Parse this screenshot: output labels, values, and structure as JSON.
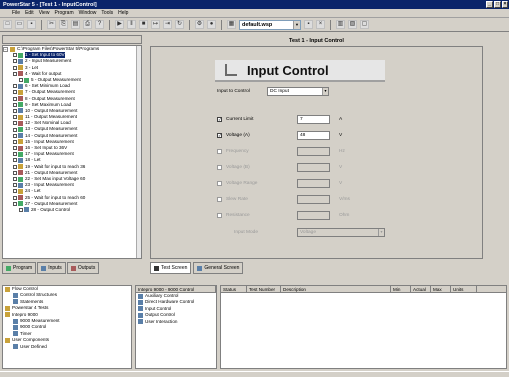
{
  "window": {
    "title": "PowerStar 5 - [Test 1 - InputControl]"
  },
  "menu": [
    "File",
    "Edit",
    "View",
    "Program",
    "Window",
    "Tools",
    "Help"
  ],
  "toolbar": {
    "workspace_combo": "default.wsp"
  },
  "tree": {
    "root": "C:\\Program Files\\PowerStar 5\\Programs",
    "items": [
      "1 - Set Input to 60V",
      "2 - Input Measurement",
      "3 - Let",
      "4 - Wait for output",
      "5 - Output Measurement",
      "6 - Set Minimum Load",
      "7 - Output Measurement",
      "8 - Output Measurement",
      "9 - Set Maximum Load",
      "10 - Output Measurement",
      "11 - Output Measurement",
      "12 - Set Nominal Load",
      "13 - Output Measurement",
      "14 - Output Measurement",
      "15 - Input Measurement",
      "16 - Set Input to 36V",
      "17 - Input Measurement",
      "18 - Let",
      "19 - Wait for input to reach 36",
      "21 - Output Measurement",
      "22 - Set Max input Voltage 60",
      "23 - Input Measurement",
      "24 - Let",
      "25 - Wait for input to reach 60",
      "27 - Output Measurement",
      "28 - Output Control"
    ]
  },
  "left_tabs": [
    "Program",
    "Inputs",
    "Outputs"
  ],
  "content": {
    "header": "Test 1 - Input Control",
    "title": "Input Control",
    "input_to_control_label": "Input to Control",
    "input_to_control_value": "DC Input",
    "fields": [
      {
        "label": "Current Limit",
        "value": "7",
        "unit": "A",
        "checked": true,
        "enabled": true
      },
      {
        "label": "Voltage (A)",
        "value": "48",
        "unit": "V",
        "checked": true,
        "enabled": true
      },
      {
        "label": "Frequency",
        "value": "",
        "unit": "Hz",
        "checked": false,
        "enabled": false
      },
      {
        "label": "Voltage (B)",
        "value": "",
        "unit": "V",
        "checked": false,
        "enabled": false
      },
      {
        "label": "Voltage Range",
        "value": "",
        "unit": "V",
        "checked": false,
        "enabled": false
      },
      {
        "label": "Slew Rate",
        "value": "",
        "unit": "V/ms",
        "checked": false,
        "enabled": false
      },
      {
        "label": "Resistance",
        "value": "",
        "unit": "Ohm",
        "checked": false,
        "enabled": false
      }
    ],
    "mode_label": "Input Mode",
    "mode_value": "Voltage"
  },
  "mid_tabs": [
    "Test Screen",
    "General Screen"
  ],
  "lib_tree": [
    "Flow Control",
    "Control Structures",
    "Statements",
    "Powerstar 4 Tests",
    "Intepro 9000",
    "9000 Measurement",
    "9000 Control",
    "Timer",
    "User Components",
    "User Defined"
  ],
  "lib_list": {
    "header": "Intepro 9000 - 9000 Control",
    "items": [
      "Auxiliary Control",
      "Direct Hardware Control",
      "Input Control",
      "Output Control",
      "User Interaction"
    ]
  },
  "results_grid": {
    "columns": [
      "Status",
      "Test Number",
      "Description",
      "Min",
      "Actual",
      "Max",
      "Units"
    ]
  }
}
